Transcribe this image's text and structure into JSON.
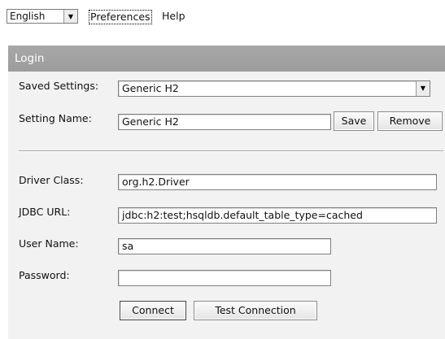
{
  "topbar": {
    "language_value": "English",
    "preferences_link": "Preferences",
    "help_link": "Help"
  },
  "login": {
    "title": "Login",
    "saved_settings": {
      "label": "Saved Settings:",
      "value": "Generic H2"
    },
    "setting_name": {
      "label": "Setting Name:",
      "value": "Generic H2"
    },
    "save_label": "Save",
    "remove_label": "Remove",
    "driver_class": {
      "label": "Driver Class:",
      "value": "org.h2.Driver"
    },
    "jdbc_url": {
      "label": "JDBC URL:",
      "value": "jdbc:h2:test;hsqldb.default_table_type=cached"
    },
    "user_name": {
      "label": "User Name:",
      "value": "sa"
    },
    "password": {
      "label": "Password:",
      "value": ""
    },
    "connect_label": "Connect",
    "test_connection_label": "Test Connection"
  },
  "icons": {
    "dropdown": "chevron-down-icon"
  },
  "colors": {
    "header_bg": "#a0a0a0",
    "panel_bg": "#f2f2f2"
  }
}
